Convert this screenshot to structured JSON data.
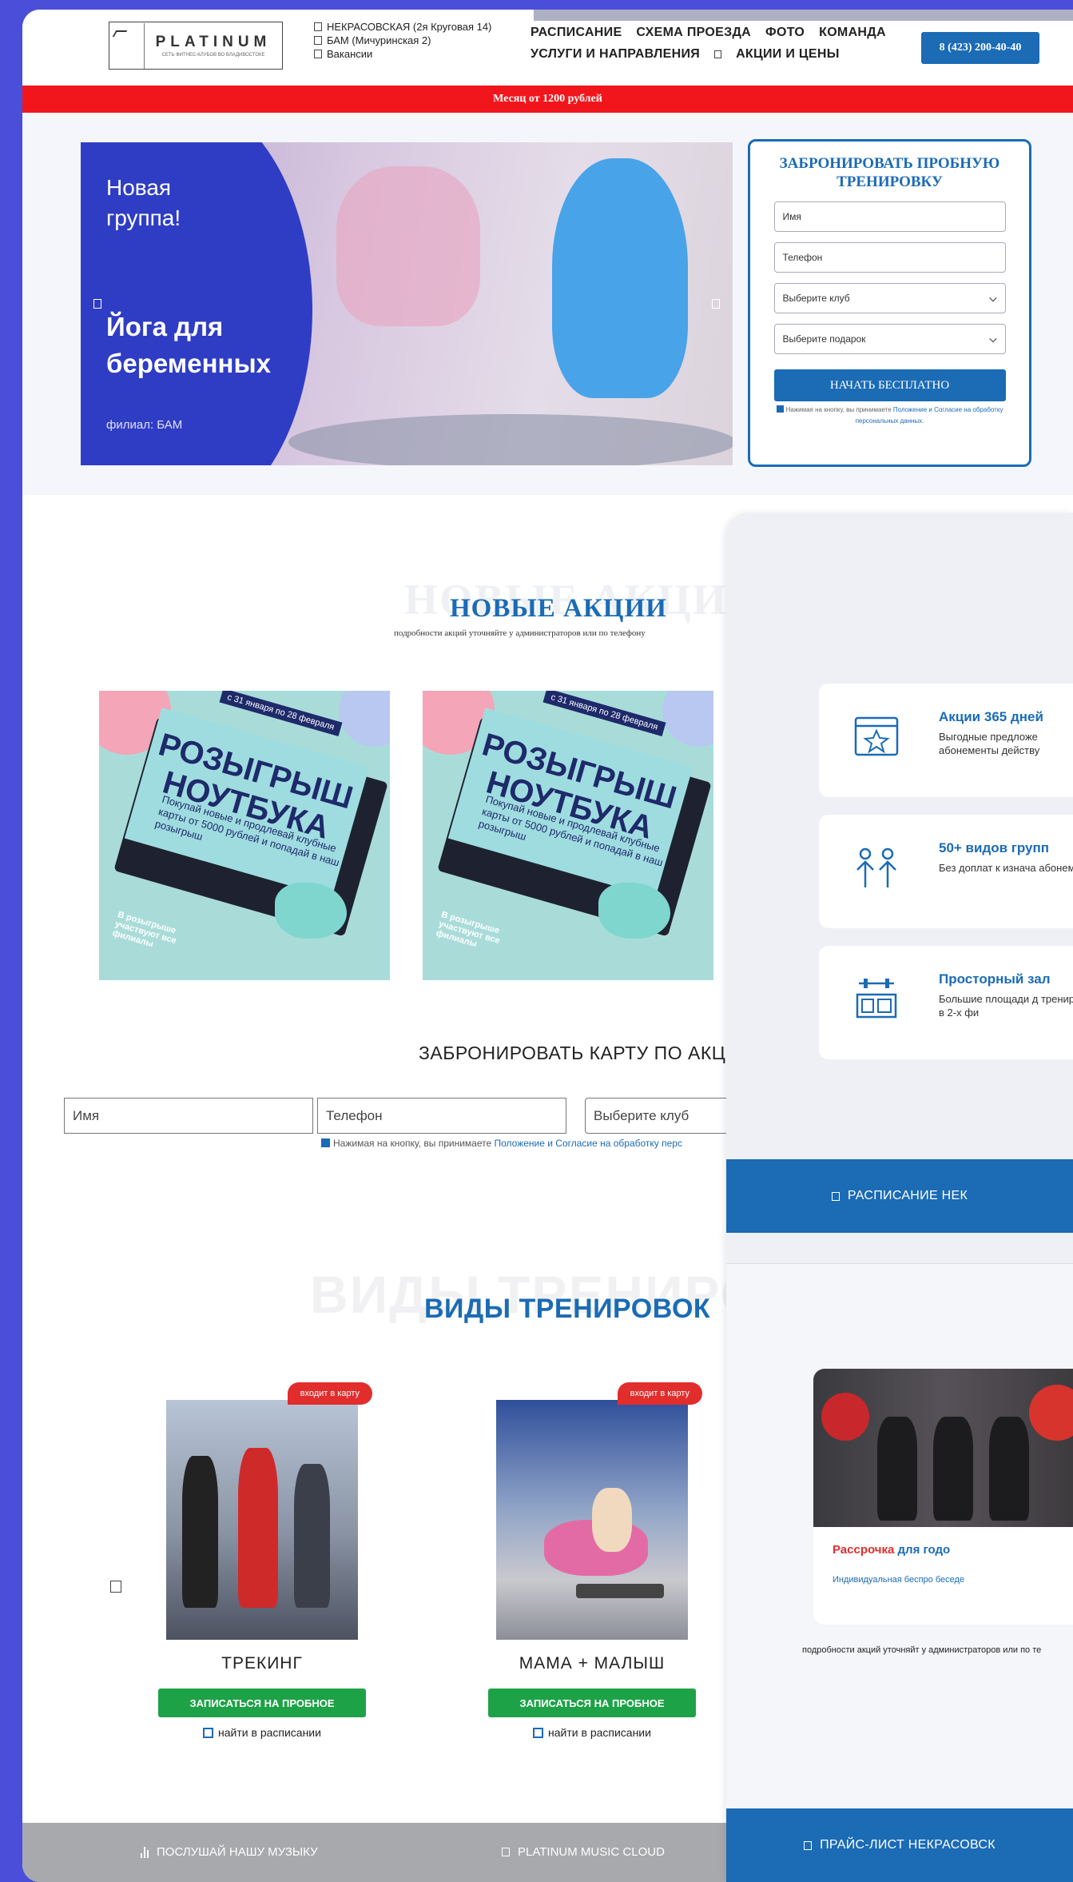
{
  "header": {
    "logo_name": "PLATINUM",
    "logo_sub": "СЕТЬ ФИТНЕС-КЛУБОВ ВО ВЛАДИВОСТОКЕ",
    "branches": [
      "НЕКРАСОВСКАЯ (2я Круговая 14)",
      "БАМ (Мичуринская 2)",
      "Вакансии"
    ],
    "nav_row1": [
      "РАСПИСАНИЕ",
      "СХЕМА ПРОЕЗДА",
      "ФОТО",
      "КОМАНДА"
    ],
    "nav_row2": [
      "УСЛУГИ И НАПРАВЛЕНИЯ",
      "АКЦИИ И ЦЕНЫ"
    ],
    "phone": "8 (423) 200-40-40"
  },
  "promo_bar": "Месяц от 1200 рублей",
  "hero": {
    "line1": "Новая группа!",
    "line2": "Йога для беременных",
    "branch": "филиал: БАМ"
  },
  "trial_form": {
    "title": "ЗАБРОНИРОВАТЬ ПРОБНУЮ ТРЕНИРОВКУ",
    "name_placeholder": "Имя",
    "phone_placeholder": "Телефон",
    "club_select": "Выберите клуб",
    "gift_select": "Выберите подарок",
    "submit": "НАЧАТЬ БЕСПЛАТНО",
    "consent_text": "Нажимая на кнопку, вы принимаете",
    "consent_link": "Положение и Согласие на обработку персональных данных."
  },
  "promotions": {
    "ghost": "НОВЫЕ АКЦИИ",
    "title": "НОВЫЕ АКЦИИ",
    "subtitle": "подробности акций уточняйте у администраторов или по телефону",
    "card": {
      "dates": "с 31 января по 28 февраля",
      "headline": "РОЗЫГРЫШ НОУТБУКА",
      "description": "Покупай новые и продлевай клубные карты от 5000 рублей и попадай в наш розыгрыш",
      "note": "В розыгрыше участвуют все филиалы"
    }
  },
  "card_booking": {
    "title": "ЗАБРОНИРОВАТЬ КАРТУ ПО АКЦИИ",
    "name_placeholder": "Имя",
    "phone_placeholder": "Телефон",
    "club_select": "Выберите клуб",
    "consent_text": "Нажимая на кнопку, вы принимаете",
    "consent_link": "Положение и Согласие на обработку перс"
  },
  "trainings": {
    "ghost": "ВИДЫ ТРЕНИРОВ",
    "title": "ВИДЫ ТРЕНИРОВОК",
    "items": [
      {
        "tag": "входит в карту",
        "label": "ТРЕКИНГ",
        "cta": "ЗАПИСАТЬСЯ НА ПРОБНОЕ",
        "find": "найти в расписании"
      },
      {
        "tag": "входит в карту",
        "label": "МАМА + МАЛЫШ",
        "cta": "ЗАПИСАТЬСЯ НА ПРОБНОЕ",
        "find": "найти в расписании"
      }
    ]
  },
  "music_bar": {
    "listen": "ПОСЛУШАЙ НАШУ МУЗЫКУ",
    "cloud": "PLATINUM MUSIC CLOUD"
  },
  "panel": {
    "features": [
      {
        "icon": "calendar-star-icon",
        "title": "Акции 365 дней",
        "desc": "Выгодные предложе абонементы действу"
      },
      {
        "icon": "group-people-icon",
        "title": "50+ видов групп",
        "desc": "Без доплат к изнача абонемента"
      },
      {
        "icon": "gym-equipment-icon",
        "title": "Просторный зал",
        "desc": "Большие площади д тренировок в 2-х фи"
      }
    ],
    "schedule_button": "РАСПИСАНИЕ НЕК",
    "installment": {
      "title_red": "Рассрочка",
      "title_blue": "для годо",
      "desc": "Индивидуальная беспро беседе"
    },
    "installment_note": "подробности акций уточняйт у администраторов или по те",
    "price_button": "ПРАЙС-ЛИСТ НЕКРАСОВСК"
  }
}
